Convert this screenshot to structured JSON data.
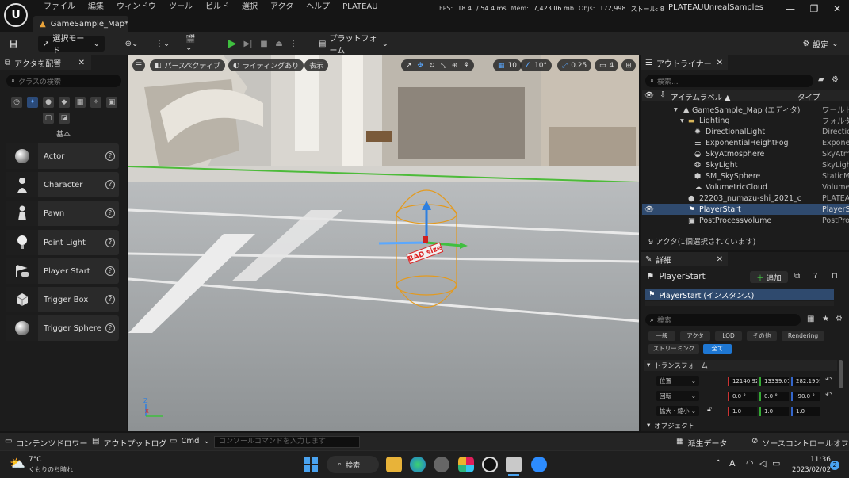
{
  "titlebar": {
    "logo": "U",
    "menu": [
      "ファイル",
      "編集",
      "ウィンドウ",
      "ツール",
      "ビルド",
      "選択",
      "アクタ",
      "ヘルプ",
      "PLATEAU"
    ],
    "stats": {
      "fps_label": "FPS:",
      "fps": "18.4",
      "ms": "/ 54.4 ms",
      "mem_label": "Mem:",
      "mem": "7,423.06 mb",
      "objs_label": "Objs:",
      "objs": "172,998",
      "stall": "ストール: 8"
    },
    "project": "PLATEAUUnrealSamples",
    "doc_tab": "GameSample_Map*",
    "min": "—",
    "max": "❐",
    "close": "✕"
  },
  "toolbar": {
    "mode": "選択モード",
    "platform": "プラットフォーム",
    "settings": "設定"
  },
  "place_actors": {
    "tab_title": "アクタを配置",
    "search_placeholder": "クラスの検索",
    "section": "基本",
    "items": [
      "Actor",
      "Character",
      "Pawn",
      "Point Light",
      "Player Start",
      "Trigger Box",
      "Trigger Sphere"
    ],
    "help": "?"
  },
  "viewport": {
    "perspective": "パースペクティブ",
    "lighting": "ライティングあり",
    "show": "表示",
    "grid": "10",
    "angle": "10°",
    "scale": "0.25",
    "cam": "4",
    "badsize": "BAD size",
    "axis_z": "Z",
    "axis_x": "X"
  },
  "outliner": {
    "tab_title": "アウトライナー",
    "search_placeholder": "検索...",
    "col_label": "アイテムラベル ▲",
    "col_type": "タイプ",
    "rows": [
      {
        "name": "GameSample_Map (エディタ)",
        "type": "ワールド"
      },
      {
        "name": "Lighting",
        "type": "フォルダ"
      },
      {
        "name": "DirectionalLight",
        "type": "DirectionalLig"
      },
      {
        "name": "ExponentialHeightFog",
        "type": "ExponentialHe"
      },
      {
        "name": "SkyAtmosphere",
        "type": "SkyAtmosphe"
      },
      {
        "name": "SkyLight",
        "type": "SkyLight"
      },
      {
        "name": "SM_SkySphere",
        "type": "StaticMeshAc"
      },
      {
        "name": "VolumetricCloud",
        "type": "VolumetricClo"
      },
      {
        "name": "22203_numazu-shi_2021_c",
        "type": "PLATEAUInst"
      },
      {
        "name": "PlayerStart",
        "type": "PlayerStart"
      },
      {
        "name": "PostProcessVolume",
        "type": "PostProcessV"
      }
    ],
    "footer": "9 アクタ(1個選択されています)"
  },
  "details": {
    "tab_title": "詳細",
    "actor_name": "PlayerStart",
    "add": "追加",
    "instance": "PlayerStart (インスタンス)",
    "search_placeholder": "検索",
    "filters": [
      "一般",
      "アクタ",
      "LOD",
      "その他",
      "Rendering"
    ],
    "filters2": [
      "ストリーミング",
      "全て"
    ],
    "transform_header": "トランスフォーム",
    "location_label": "位置",
    "rotation_label": "回転",
    "scale_label": "拡大・縮小",
    "location": [
      "12140.92",
      "13339.01",
      "282.1909"
    ],
    "rotation": [
      "0.0 °",
      "0.0 °",
      "-90.0 °"
    ],
    "scale": [
      "1.0",
      "1.0",
      "1.0"
    ],
    "object_header": "オブジェクト"
  },
  "bottombar": {
    "content_drawer": "コンテンツドロワー",
    "output_log": "アウトプットログ",
    "cmd": "Cmd",
    "console_placeholder": "コンソールコマンドを入力します",
    "derived": "派生データ",
    "source_control": "ソースコントロールオフ"
  },
  "taskbar": {
    "temp": "7°C",
    "weather": "くもりのち晴れ",
    "search": "検索",
    "ime": "A",
    "time": "11:36",
    "date": "2023/02/02",
    "notif": "2"
  }
}
